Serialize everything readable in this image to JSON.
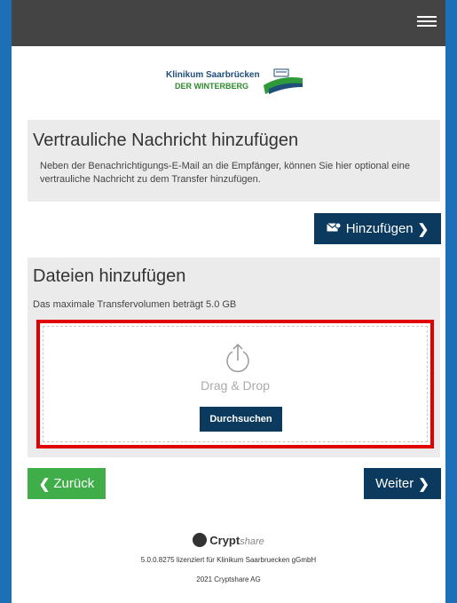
{
  "header": {
    "menu_icon": "hamburger-menu-icon"
  },
  "logo": {
    "line1": "Klinikum Saarbrücken",
    "line2": "DER WINTERBERG"
  },
  "message_section": {
    "title": "Vertrauliche Nachricht hinzufügen",
    "description": "Neben der Benachrichtigungs-E-Mail an die Empfänger, können Sie hier optional eine vertrauliche Nachricht zu dem Transfer hinzufügen.",
    "add_button_label": "Hinzufügen",
    "add_button_icon": "envelope-icon"
  },
  "files_section": {
    "title": "Dateien hinzufügen",
    "description": "Das maximale Transfervolumen beträgt 5.0 GB",
    "drop_text": "Drag & Drop",
    "browse_label": "Durchsuchen",
    "upload_icon": "upload-icon"
  },
  "navigation": {
    "back_label": "Zurück",
    "next_label": "Weiter"
  },
  "footer": {
    "brand_bold": "Crypt",
    "brand_light": "share",
    "license_text": "5.0.0.8275 lizenziert für Klinikum Saarbruecken gGmbH",
    "copyright": "2021 Cryptshare AG"
  },
  "colors": {
    "frame": "#1d6fb8",
    "topbar": "#444444",
    "primary_button": "#0b3a5e",
    "back_button": "#3fae49",
    "highlight": "#e00000",
    "panel": "#ebebeb"
  }
}
